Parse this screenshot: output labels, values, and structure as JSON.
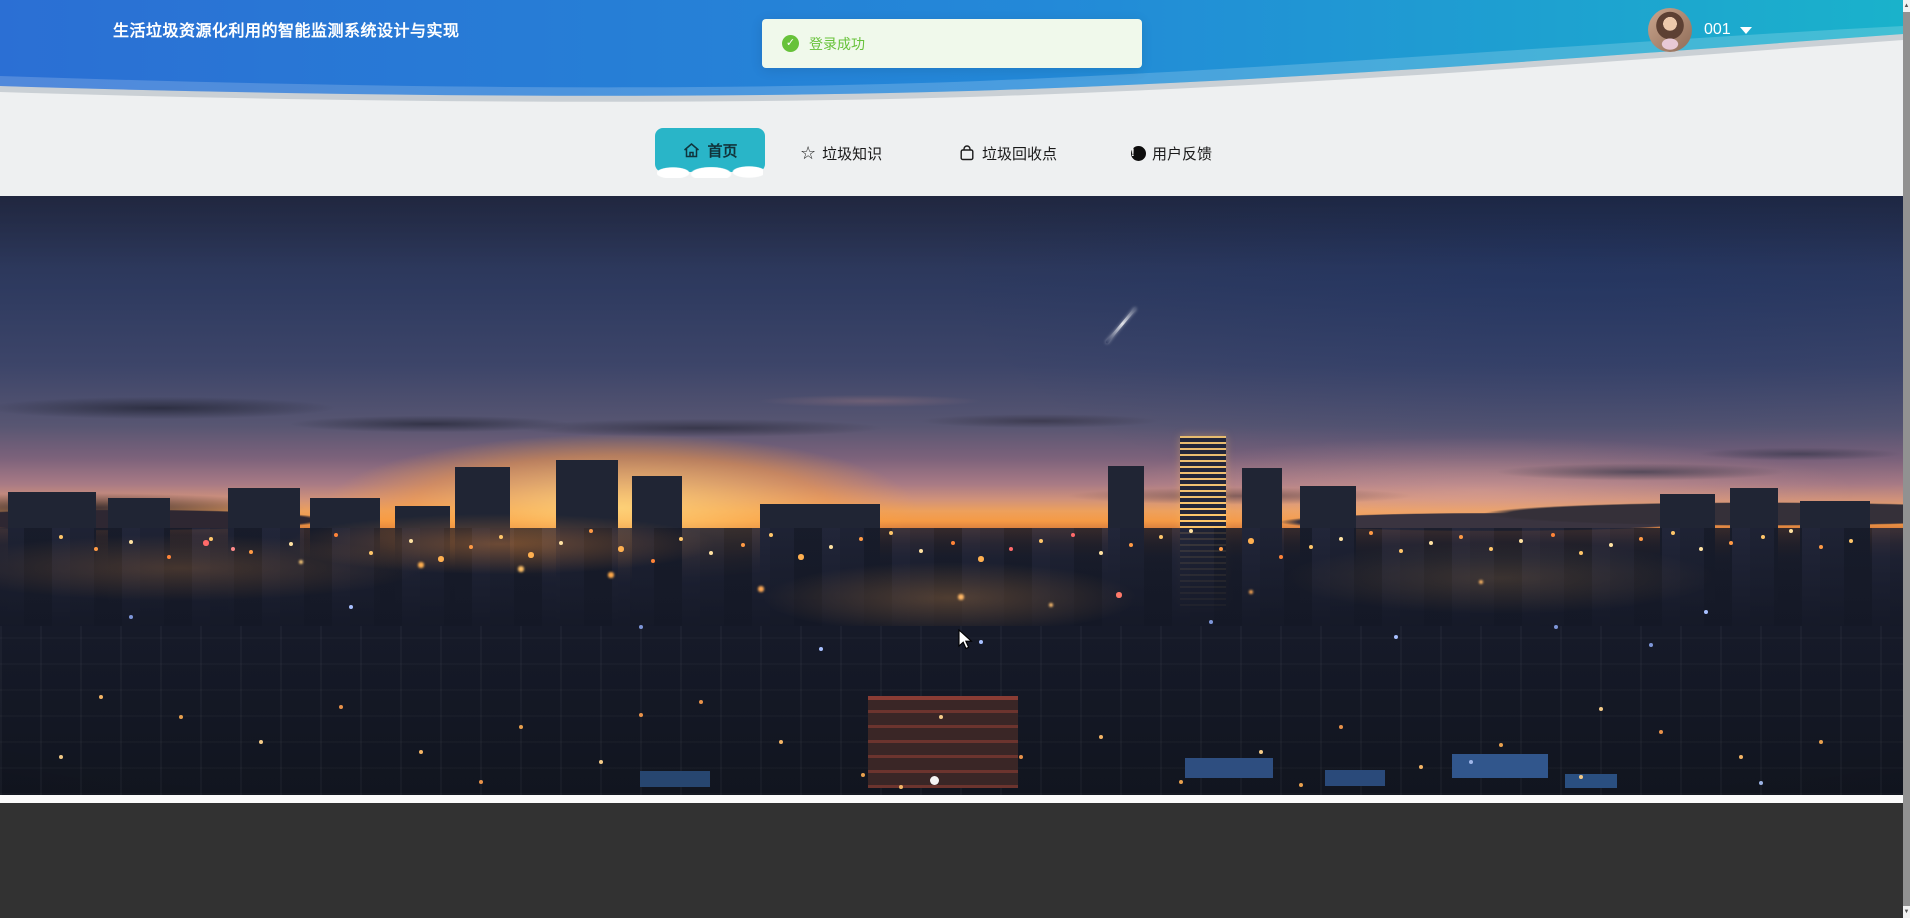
{
  "header": {
    "title": "生活垃圾资源化利用的智能监测系统设计与实现",
    "user": {
      "name": "001",
      "avatar_icon": "user-avatar-photo",
      "caret_icon": "caret-down-icon"
    },
    "colors": {
      "gradient_left": "#2b6fd4",
      "gradient_right": "#1ab2cb"
    }
  },
  "toast": {
    "message": "登录成功",
    "icon": "success-check-icon",
    "bg": "#f0f9eb",
    "text_color": "#67c23a"
  },
  "nav": {
    "active_bg": "#29b5c8",
    "tabs": [
      {
        "label": "首页",
        "icon": "home-icon",
        "active": true
      },
      {
        "label": "垃圾知识",
        "icon": "star-icon",
        "active": false
      },
      {
        "label": "垃圾回收点",
        "icon": "bag-icon",
        "active": false
      },
      {
        "label": "用户反馈",
        "icon": "alert-icon",
        "active": false
      }
    ]
  },
  "hero": {
    "description": "city-sunset-skyline-photo",
    "indicator_count": 1,
    "active_indicator": 0
  },
  "footer": {
    "bg": "#323232"
  }
}
